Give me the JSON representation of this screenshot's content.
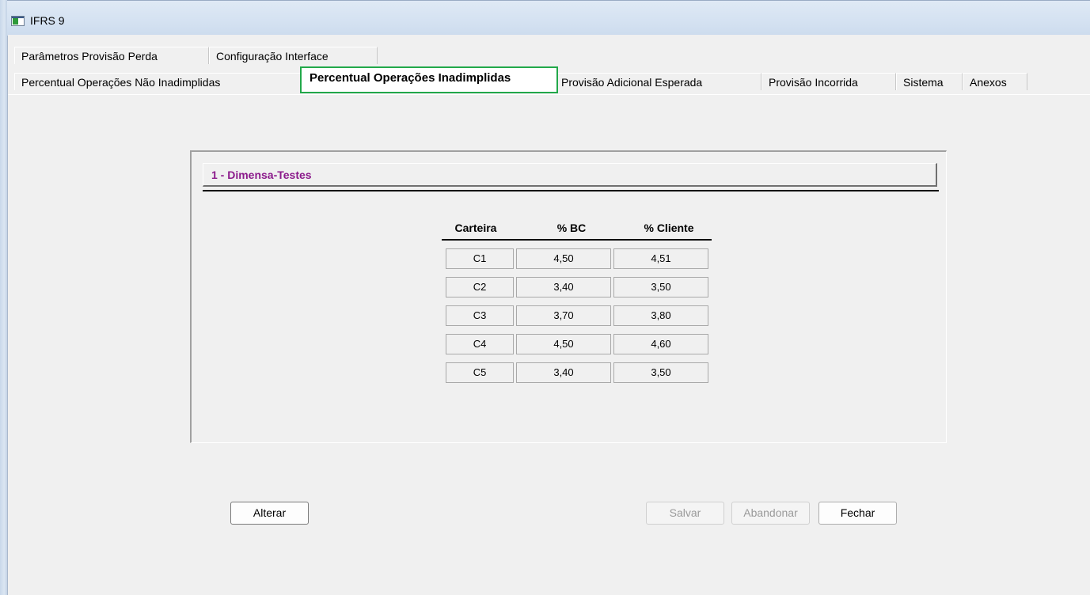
{
  "window": {
    "title": "IFRS 9"
  },
  "tabs_row1": [
    {
      "label": "Parâmetros Provisão Perda"
    },
    {
      "label": "Configuração Interface"
    }
  ],
  "tabs_row2": [
    {
      "label": "Percentual Operações Não Inadimplidas"
    },
    {
      "label": "Percentual Operações Inadimplidas",
      "active": true
    },
    {
      "label": "Provisão Adicional Esperada"
    },
    {
      "label": "Provisão Incorrida"
    },
    {
      "label": "Sistema"
    },
    {
      "label": "Anexos"
    }
  ],
  "section": {
    "title": "1 - Dimensa-Testes"
  },
  "table": {
    "headers": [
      "Carteira",
      "% BC",
      "% Cliente"
    ],
    "rows": [
      [
        "C1",
        "4,50",
        "4,51"
      ],
      [
        "C2",
        "3,40",
        "3,50"
      ],
      [
        "C3",
        "3,70",
        "3,80"
      ],
      [
        "C4",
        "4,50",
        "4,60"
      ],
      [
        "C5",
        "3,40",
        "3,50"
      ]
    ]
  },
  "buttons": {
    "alterar": "Alterar",
    "salvar": "Salvar",
    "abandonar": "Abandonar",
    "fechar": "Fechar"
  },
  "colors": {
    "accent_tab_border": "#22a84a",
    "section_title": "#8b1a8b"
  }
}
